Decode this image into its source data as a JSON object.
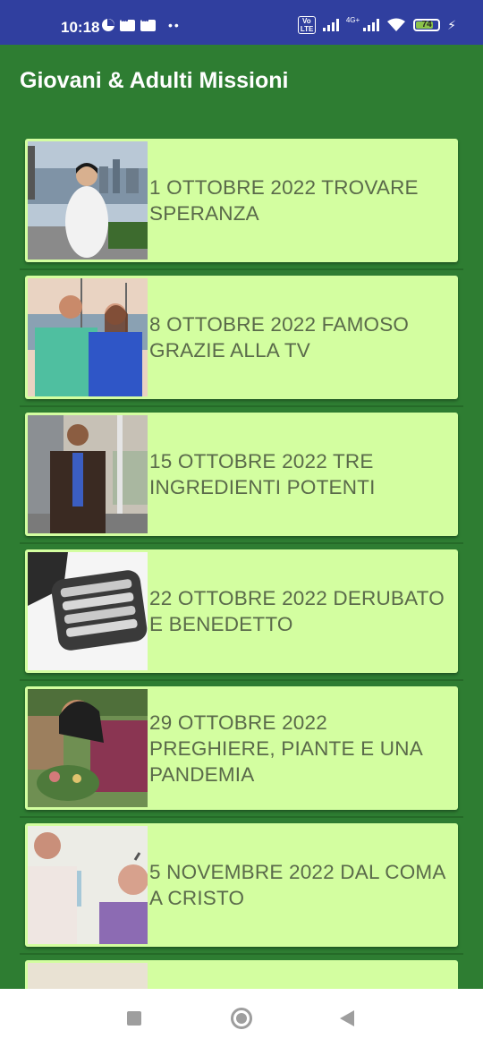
{
  "status_bar": {
    "time": "10:18",
    "battery_level": "74",
    "network": "4G+",
    "volte": "Vo LTE"
  },
  "app_bar": {
    "title": "Giovani & Adulti Missioni"
  },
  "list": {
    "items": [
      {
        "title": "1 OTTOBRE 2022 TROVARE SPERANZA",
        "thumbnail": "woman-by-harbor-photo"
      },
      {
        "title": "8 OTTOBRE 2022 FAMOSO GRAZIE ALLA TV",
        "thumbnail": "couple-at-marina-photo"
      },
      {
        "title": "15 OTTOBRE 2022 TRE INGREDIENTI POTENTI",
        "thumbnail": "man-in-blazer-photo"
      },
      {
        "title": "22 OTTOBRE 2022 DERUBATO E BENEDETTO",
        "thumbnail": "electric-shaver-photo"
      },
      {
        "title": "29 OTTOBRE 2022 PREGHIERE, PIANTE E UNA PANDEMIA",
        "thumbnail": "woman-with-plants-photo"
      },
      {
        "title": "5 NOVEMBRE 2022 DAL COMA A CRISTO",
        "thumbnail": "two-men-smiling-photo"
      }
    ]
  },
  "nav_bar": {
    "icons": [
      "recents-square-icon",
      "home-circle-icon",
      "back-triangle-icon"
    ]
  },
  "colors": {
    "status_bar": "#303f9f",
    "app_background": "#2e7d32",
    "card_background": "#d3fea0",
    "card_text": "#5a6a4a"
  }
}
